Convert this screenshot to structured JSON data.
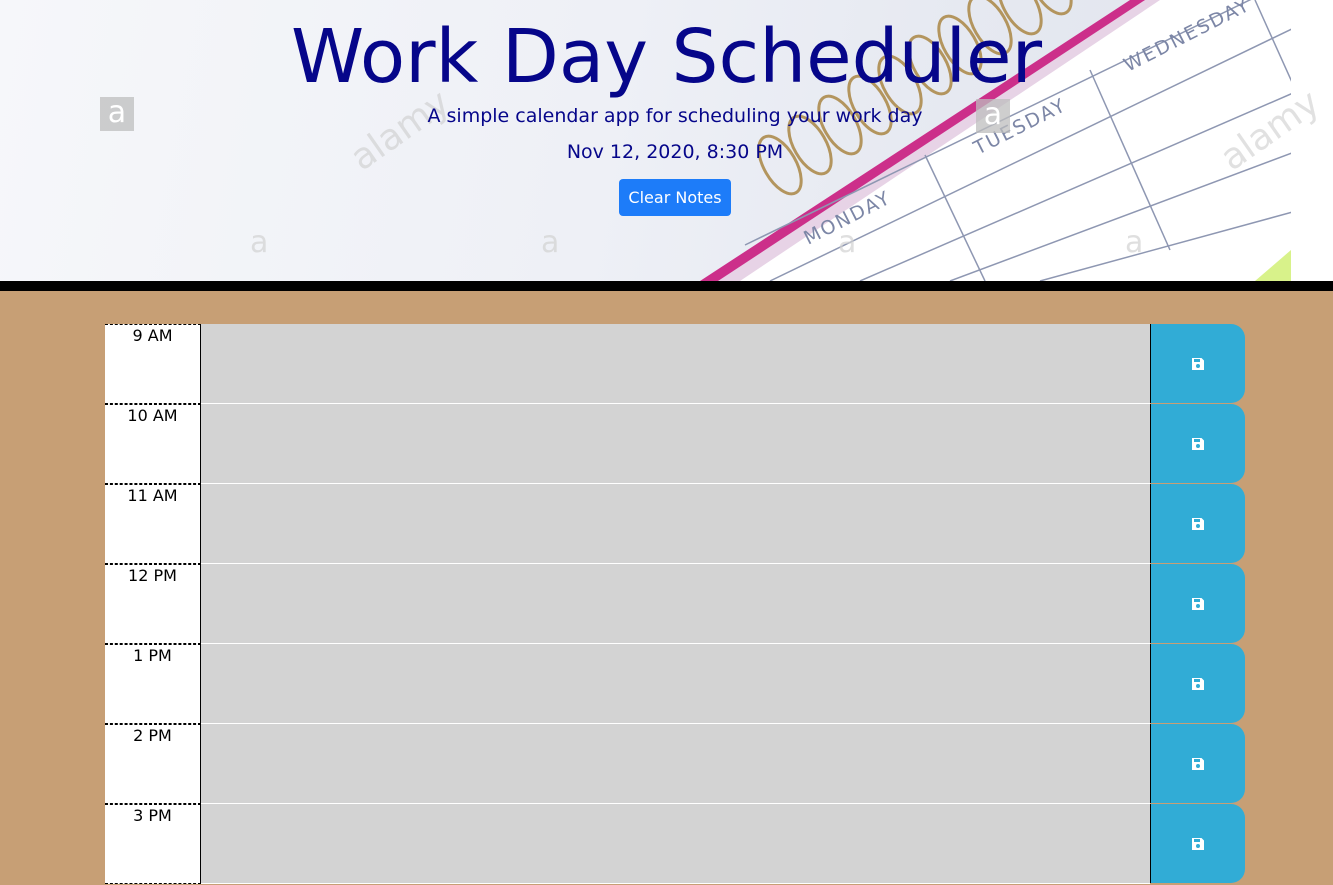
{
  "header": {
    "title": "Work Day Scheduler",
    "subtitle": "A simple calendar app for scheduling your work day",
    "current_date": "Nov 12, 2020, 8:30 PM",
    "clear_button_label": "Clear Notes",
    "planner_days": [
      "MONDAY",
      "TUESDAY",
      "WEDNESDAY"
    ],
    "watermark": "alamy"
  },
  "colors": {
    "title": "#06068a",
    "clear_button": "#1d7cf9",
    "page_background": "#c79f75",
    "note_background": "#d3d3d3",
    "save_button": "#31acd6"
  },
  "time_blocks": [
    {
      "hour": "9 AM",
      "note": "",
      "save_icon": "floppy-disk-icon"
    },
    {
      "hour": "10 AM",
      "note": "",
      "save_icon": "floppy-disk-icon"
    },
    {
      "hour": "11 AM",
      "note": "",
      "save_icon": "floppy-disk-icon"
    },
    {
      "hour": "12 PM",
      "note": "",
      "save_icon": "floppy-disk-icon"
    },
    {
      "hour": "1 PM",
      "note": "",
      "save_icon": "floppy-disk-icon"
    },
    {
      "hour": "2 PM",
      "note": "",
      "save_icon": "floppy-disk-icon"
    },
    {
      "hour": "3 PM",
      "note": "",
      "save_icon": "floppy-disk-icon"
    }
  ]
}
